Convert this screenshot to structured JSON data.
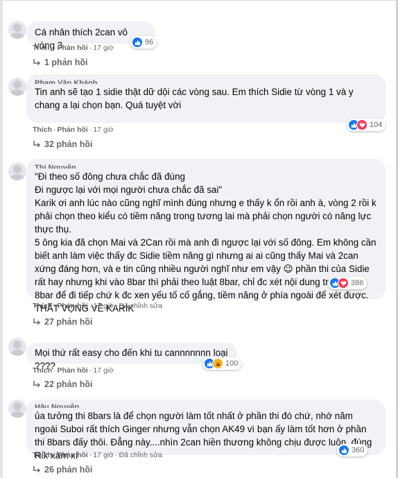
{
  "comments": [
    {
      "author": "",
      "text": "Cá nhân thích 2can vô vòng 3",
      "like_label": "Thích",
      "reply_label": "Phản hồi",
      "time": "17 giờ",
      "edited": "",
      "reactions": [
        "like"
      ],
      "reaction_count": "96",
      "replies": "1 phản hồi"
    },
    {
      "author": "Phạm Văn Khánh",
      "text": "Tin anh sẽ tạo 1 sidie thật dữ dội các vòng sau. Em thích Sidie từ vòng 1 và y chang a lại chọn bạn. Quá tuyệt vời",
      "like_label": "Thích",
      "reply_label": "Phản hồi",
      "time": "17 giờ",
      "edited": "",
      "reactions": [
        "like",
        "love"
      ],
      "reaction_count": "104",
      "replies": "32 phản hồi"
    },
    {
      "author": "Thi Nguyễn",
      "text": "\"Đi theo số đông chưa chắc đã đúng\nĐi ngược lại với mọi người chưa chắc đã sai\"\nKarik ơi anh lúc nào cũng nghĩ mình đúng nhưng e thấy k ổn rồi anh à, vòng 2 rồi k phải chọn theo kiểu có tiềm năng trong tương lai mà phải chọn người có năng lực thực thụ.\n5 ông kia đã chọn Mai và 2Can rồi mà anh đi ngược lại với số đông. Em không cần biết anh làm việc thấy đc Sidie tiềm năng gì nhưng ai ai cũng thấy Mai và 2can xứng đáng hơn, và e tin cũng nhiều người nghĩ như em vậy 😉 phần thi của Sidie rất hay nhưng khi vào 8bar thì phải theo luật 8bar, chỉ đc xét nội dung trong phần 8bar để đi tiếp chứ k đc xen yếu tố cố gắng, tiềm năng ở phía ngoài để xét được. THẤT VỌNG VỀ KARIK",
      "like_label": "Thích",
      "reply_label": "Phản hồi",
      "time": "17 giờ",
      "edited": "Đã chỉnh sửa",
      "reactions": [
        "like",
        "love"
      ],
      "reaction_count": "386",
      "replies": "27 phản hồi"
    },
    {
      "author": "",
      "text": "Mọi thứ rất easy cho đến khi tu cannnnnnn loại ????",
      "like_label": "Thích",
      "reply_label": "Phản hồi",
      "time": "17 giờ",
      "edited": "",
      "reactions": [
        "like",
        "haha"
      ],
      "reaction_count": "100",
      "replies": "22 phản hồi"
    },
    {
      "author": "Hậu Nguyễn",
      "text": "ủa tưởng thi 8bars là để chọn người làm tốt nhất ở phần thi đó chứ, nhớ năm ngoái Suboi rất thích Ginger nhưng vẫn chọn AK49 vì bạn ấy làm tốt hơn ở phần thi 8bars đấy thôi. Đẳng này....nhìn 2can hiền thương không chịu được luôn, đúng Rik xàm xí",
      "like_label": "Thích",
      "reply_label": "Phản hồi",
      "time": "17 giờ",
      "edited": "Đã chỉnh sửa",
      "reactions": [
        "like"
      ],
      "reaction_count": "360",
      "replies": "26 phản hồi"
    }
  ]
}
